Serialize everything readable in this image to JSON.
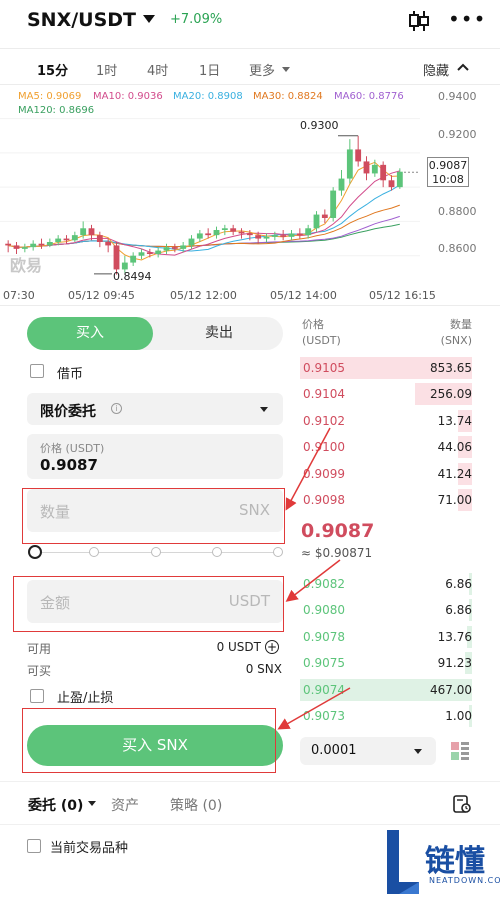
{
  "header": {
    "pair": "SNX/USDT",
    "change": "+7.09%"
  },
  "timeframes": [
    {
      "label": "15分",
      "active": true
    },
    {
      "label": "1时",
      "active": false
    },
    {
      "label": "4时",
      "active": false
    },
    {
      "label": "1日",
      "active": false
    },
    {
      "label": "更多",
      "active": false
    }
  ],
  "hide_label": "隐藏",
  "ma_labels": [
    {
      "text": "MA5: 0.9069",
      "color": "#f0a030"
    },
    {
      "text": "MA10: 0.9036",
      "color": "#d24c8c"
    },
    {
      "text": "MA20: 0.8908",
      "color": "#3ab0e0"
    },
    {
      "text": "MA30: 0.8824",
      "color": "#e07820"
    },
    {
      "text": "MA60: 0.8776",
      "color": "#a060d0"
    },
    {
      "text": "MA120: 0.8696",
      "color": "#3aa060"
    }
  ],
  "chart_data": {
    "type": "candlestick",
    "y_ticks": [
      "0.9400",
      "0.9200",
      "0.9087",
      "0.8800",
      "0.8600"
    ],
    "x_ticks": [
      "07:30",
      "05/12 09:45",
      "05/12 12:00",
      "05/12 14:00",
      "05/12 16:15"
    ],
    "high_label": "0.9300",
    "low_label": "0.8494",
    "last_price": "0.9087",
    "countdown": "10:08",
    "ylim": [
      0.84,
      0.945
    ],
    "candles": [
      [
        0.867,
        0.866,
        0.869,
        0.862
      ],
      [
        0.866,
        0.864,
        0.868,
        0.861
      ],
      [
        0.864,
        0.865,
        0.867,
        0.862
      ],
      [
        0.865,
        0.867,
        0.869,
        0.863
      ],
      [
        0.867,
        0.866,
        0.87,
        0.864
      ],
      [
        0.866,
        0.868,
        0.87,
        0.865
      ],
      [
        0.868,
        0.87,
        0.872,
        0.866
      ],
      [
        0.87,
        0.869,
        0.872,
        0.867
      ],
      [
        0.869,
        0.872,
        0.874,
        0.868
      ],
      [
        0.872,
        0.876,
        0.88,
        0.87
      ],
      [
        0.876,
        0.872,
        0.878,
        0.869
      ],
      [
        0.872,
        0.868,
        0.874,
        0.865
      ],
      [
        0.868,
        0.866,
        0.87,
        0.862
      ],
      [
        0.866,
        0.852,
        0.868,
        0.849
      ],
      [
        0.852,
        0.856,
        0.86,
        0.85
      ],
      [
        0.856,
        0.86,
        0.862,
        0.854
      ],
      [
        0.86,
        0.862,
        0.864,
        0.858
      ],
      [
        0.862,
        0.861,
        0.864,
        0.859
      ],
      [
        0.861,
        0.863,
        0.865,
        0.859
      ],
      [
        0.863,
        0.865,
        0.867,
        0.861
      ],
      [
        0.865,
        0.864,
        0.867,
        0.862
      ],
      [
        0.864,
        0.866,
        0.868,
        0.862
      ],
      [
        0.866,
        0.87,
        0.872,
        0.864
      ],
      [
        0.87,
        0.873,
        0.875,
        0.868
      ],
      [
        0.873,
        0.872,
        0.876,
        0.87
      ],
      [
        0.872,
        0.875,
        0.877,
        0.87
      ],
      [
        0.875,
        0.876,
        0.878,
        0.872
      ],
      [
        0.876,
        0.874,
        0.878,
        0.872
      ],
      [
        0.874,
        0.873,
        0.876,
        0.87
      ],
      [
        0.873,
        0.872,
        0.875,
        0.869
      ],
      [
        0.872,
        0.87,
        0.874,
        0.867
      ],
      [
        0.87,
        0.871,
        0.873,
        0.868
      ],
      [
        0.871,
        0.872,
        0.874,
        0.869
      ],
      [
        0.872,
        0.871,
        0.875,
        0.869
      ],
      [
        0.871,
        0.873,
        0.875,
        0.869
      ],
      [
        0.873,
        0.872,
        0.876,
        0.87
      ],
      [
        0.872,
        0.876,
        0.878,
        0.87
      ],
      [
        0.876,
        0.884,
        0.886,
        0.874
      ],
      [
        0.884,
        0.882,
        0.887,
        0.879
      ],
      [
        0.882,
        0.898,
        0.9,
        0.88
      ],
      [
        0.898,
        0.905,
        0.91,
        0.895
      ],
      [
        0.905,
        0.922,
        0.928,
        0.902
      ],
      [
        0.922,
        0.915,
        0.93,
        0.912
      ],
      [
        0.915,
        0.908,
        0.918,
        0.904
      ],
      [
        0.908,
        0.913,
        0.916,
        0.906
      ],
      [
        0.913,
        0.904,
        0.915,
        0.9
      ],
      [
        0.904,
        0.9,
        0.907,
        0.898
      ],
      [
        0.9,
        0.909,
        0.911,
        0.899
      ]
    ]
  },
  "watermark": "欧易",
  "trade": {
    "buy_tab": "买入",
    "sell_tab": "卖出",
    "borrow_label": "借币",
    "order_type": "限价委托",
    "info_glyph": "i",
    "price_label": "价格 (USDT)",
    "price_value": "0.9087",
    "amount_placeholder": "数量",
    "amount_unit": "SNX",
    "total_placeholder": "金额",
    "total_unit": "USDT",
    "available_label": "可用",
    "available_value": "0 USDT",
    "buyable_label": "可买",
    "buyable_value": "0 SNX",
    "tpsl_label": "止盈/止损",
    "buy_button": "买入 SNX",
    "plus_glyph": "+"
  },
  "orderbook": {
    "price_header": "价格",
    "price_unit": "(USDT)",
    "qty_header": "数量",
    "qty_unit": "(SNX)",
    "asks": [
      {
        "price": "0.9105",
        "qty": "853.65",
        "depth": 1.0
      },
      {
        "price": "0.9104",
        "qty": "256.09",
        "depth": 0.33
      },
      {
        "price": "0.9102",
        "qty": "13.74",
        "depth": 0.08
      },
      {
        "price": "0.9100",
        "qty": "44.06",
        "depth": 0.08
      },
      {
        "price": "0.9099",
        "qty": "41.24",
        "depth": 0.08
      },
      {
        "price": "0.9098",
        "qty": "71.00",
        "depth": 0.08
      }
    ],
    "mid_price": "0.9087",
    "mid_sub": "≈ $0.90871",
    "bids": [
      {
        "price": "0.9082",
        "qty": "6.86",
        "depth": 0.02
      },
      {
        "price": "0.9080",
        "qty": "6.86",
        "depth": 0.02
      },
      {
        "price": "0.9078",
        "qty": "13.76",
        "depth": 0.03
      },
      {
        "price": "0.9075",
        "qty": "91.23",
        "depth": 0.04
      },
      {
        "price": "0.9074",
        "qty": "467.00",
        "depth": 1.0
      },
      {
        "price": "0.9073",
        "qty": "1.00",
        "depth": 0.02
      }
    ],
    "depth_select": "0.0001"
  },
  "bottom": {
    "orders_tab": "委托 (0)",
    "assets_tab": "资产",
    "strategy_tab": "策略 (0)",
    "current_pair_label": "当前交易品种"
  },
  "brand": {
    "name": "链懂",
    "sub": "NEATDOWN.COM"
  },
  "colors": {
    "up": "#5cc47a",
    "down": "#d04c5e",
    "ask_bg": "#fbe0e4",
    "bid_bg": "#dff2e5",
    "annotation": "#e03a3a"
  }
}
